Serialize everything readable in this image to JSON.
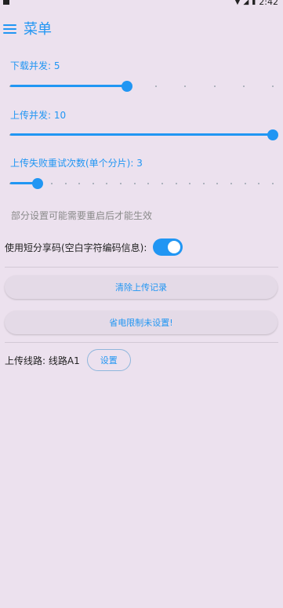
{
  "status_bar": {
    "time": "2:42"
  },
  "app_bar": {
    "title": "菜单"
  },
  "sliders": [
    {
      "label": "下载并发: 5",
      "value": 5,
      "min": 1,
      "max": 10
    },
    {
      "label": "上传并发: 10",
      "value": 10,
      "min": 1,
      "max": 10
    },
    {
      "label": "上传失败重试次数(单个分片): 3",
      "value": 3,
      "min": 1,
      "max": 20
    }
  ],
  "note": "部分设置可能需要重启后才能生效",
  "short_share": {
    "label": "使用短分享码(空白字符编码信息):",
    "enabled": true
  },
  "buttons": {
    "clear_upload": "清除上传记录",
    "power_saving": "省电限制未设置!"
  },
  "upload_route": {
    "label": "上传线路: 线路A1",
    "settings_button": "设置"
  },
  "colors": {
    "accent": "#2196f3",
    "background": "#ece1ee",
    "track_inactive": "#9aa2ad"
  }
}
